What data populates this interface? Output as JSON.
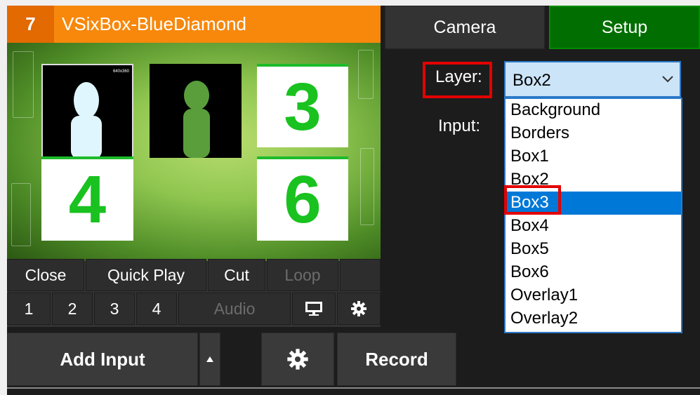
{
  "input": {
    "number": "7",
    "title": "VSixBox-BlueDiamond",
    "preview": {
      "tiles": [
        "3",
        "4",
        "6"
      ],
      "camera1_caption": "640x360"
    },
    "buttons": {
      "close": "Close",
      "quick_play": "Quick Play",
      "cut": "Cut",
      "loop": "Loop",
      "n1": "1",
      "n2": "2",
      "n3": "3",
      "n4": "4",
      "audio": "Audio"
    }
  },
  "tabs": {
    "camera": "Camera",
    "setup": "Setup"
  },
  "layer": {
    "label": "Layer:",
    "selected": "Box2",
    "options": [
      "Background",
      "Borders",
      "Box1",
      "Box2",
      "Box3",
      "Box4",
      "Box5",
      "Box6",
      "Overlay1",
      "Overlay2"
    ],
    "highlighted": "Box3"
  },
  "input_label": "Input:",
  "bottom_bar": {
    "add_input": "Add Input",
    "record": "Record"
  },
  "icons": {
    "monitor": "monitor-icon",
    "settings": "gear-icon",
    "dropdown": "chevron-down-icon",
    "arrow": "triangle-up-icon"
  },
  "colors": {
    "title_orange": "#f7880c",
    "number_orange": "#e26a00",
    "setup_green": "#006e00",
    "tile_green": "#19c21f",
    "selection_blue": "#0078d7",
    "highlight_red": "#e30000"
  }
}
